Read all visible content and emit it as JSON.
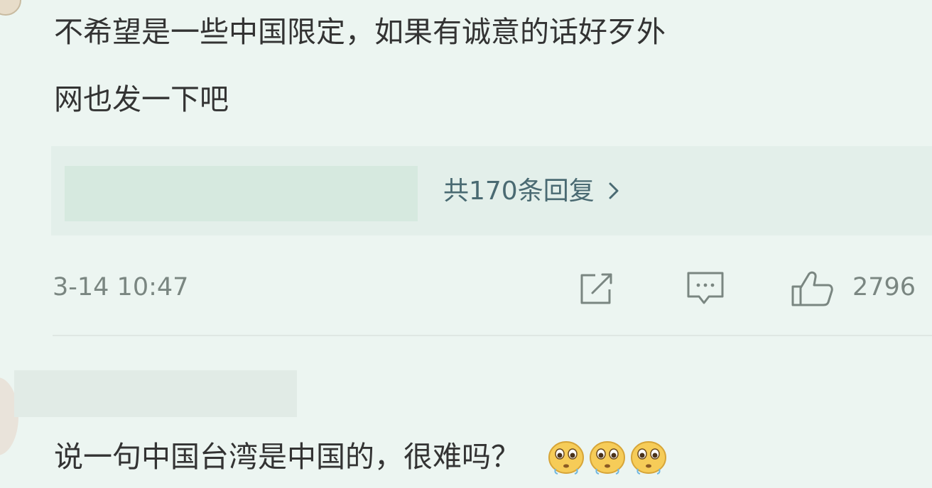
{
  "comment1": {
    "text_line1": "不希望是一些中国限定，如果有诚意的话好歹外",
    "text_line2": "网也发一下吧",
    "replies_link": "共170条回复",
    "timestamp": "3-14 10:47",
    "like_count": "2796"
  },
  "comment2": {
    "text": "说一句中国台湾是中国的，很难吗？",
    "emojis": [
      "pleading-face-emoji",
      "pleading-face-emoji",
      "pleading-face-emoji"
    ]
  },
  "icons": {
    "share": "share-icon",
    "comment": "comment-icon",
    "like": "thumbs-up-icon",
    "chevron": "chevron-right-icon"
  },
  "colors": {
    "background": "#ecf5f1",
    "primary_text": "#333333",
    "meta_text": "#7a8681",
    "link_text": "#4a6a72",
    "emoji_fill": "#f6cc58"
  }
}
